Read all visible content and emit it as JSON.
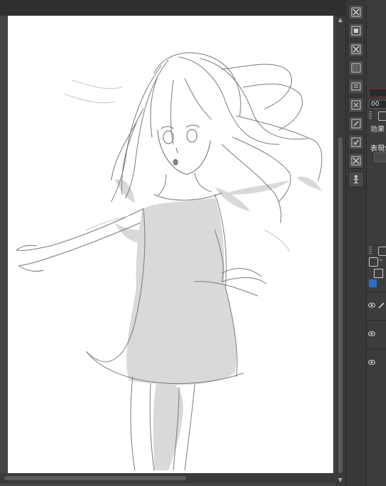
{
  "toolbar_icons": [
    "delete-layer-icon",
    "fill-layer-icon",
    "clear-layer-icon",
    "raster-layer-icon",
    "new-folder-icon",
    "merge-layer-icon",
    "edit-layer-icon",
    "check-layer-icon",
    "close-layer-icon",
    "figure-icon"
  ],
  "right_panel": {
    "opacity_value": "00",
    "effect_label": "効果",
    "display_color_label": "表現色"
  },
  "layers": [
    {
      "visible": true,
      "name": ""
    },
    {
      "visible": true,
      "name": ""
    },
    {
      "visible": true,
      "name": ""
    }
  ],
  "colors": {
    "canvas": "#ffffff",
    "workspace": "#454545",
    "panel": "#3c3c3c",
    "accent_blue": "#2d6fc4",
    "accent_red": "#b03030"
  }
}
